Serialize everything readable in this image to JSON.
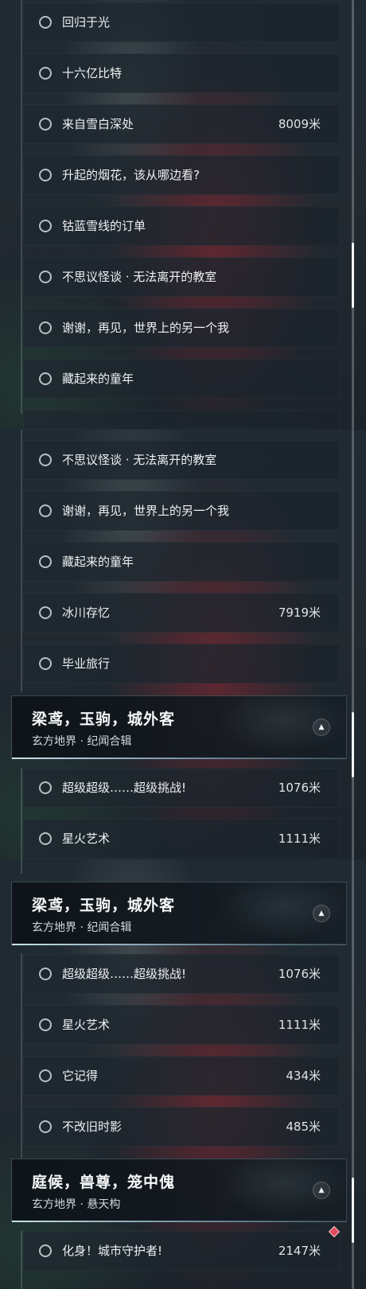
{
  "rows": {
    "huigui": {
      "title": "回归于光"
    },
    "shiliuyi": {
      "title": "十六亿比特"
    },
    "xuebai": {
      "title": "来自雪白深处",
      "distance": "8009米"
    },
    "yanhua": {
      "title": "升起的烟花，该从哪边看?"
    },
    "gulan": {
      "title": "钴蓝雪线的订单"
    },
    "jiaoshi": {
      "title": "不思议怪谈 · 无法离开的教室"
    },
    "xiexie": {
      "title": "谢谢，再见，世界上的另一个我"
    },
    "tongnian": {
      "title": "藏起来的童年"
    },
    "binchuan": {
      "title": "冰川存忆",
      "distance": "7919米"
    },
    "biye": {
      "title": "毕业旅行"
    },
    "chaoji": {
      "title": "超级超级……超级挑战!",
      "distance": "1076米"
    },
    "xinghuo": {
      "title": "星火艺术",
      "distance": "1111米"
    },
    "taji": {
      "title": "它记得",
      "distance": "434米"
    },
    "bugai": {
      "title": "不改旧时影",
      "distance": "485米"
    },
    "huashen": {
      "title": "化身！城市守护者!",
      "distance": "2147米"
    }
  },
  "groups": {
    "liangyuan": {
      "title": "梁鸢，玉驹，城外客",
      "subtitle": "玄方地界 · 纪闻合辑",
      "toggle_icon": "chevron-up-icon"
    },
    "tinghou": {
      "title": "庭候，兽尊，笼中傀",
      "subtitle": "玄方地界 · 悬天构",
      "toggle_icon": "chevron-up-icon"
    }
  },
  "colors": {
    "accent_line": "#d2ebf5",
    "new_badge": "#e0495a"
  }
}
